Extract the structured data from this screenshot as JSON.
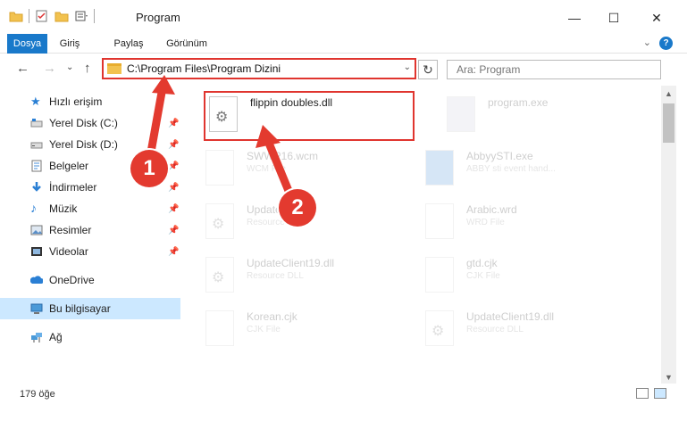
{
  "window": {
    "title": "Program",
    "minimize_glyph": "—",
    "maximize_glyph": "☐",
    "close_glyph": "✕"
  },
  "ribbon": {
    "tabs": [
      "Dosya",
      "Giriş",
      "Paylaş",
      "Görünüm"
    ],
    "expand_glyph": "⌄",
    "help_glyph": "?"
  },
  "nav": {
    "back_glyph": "←",
    "forward_glyph": "→",
    "recent_glyph": "⌄",
    "up_glyph": "↑",
    "address": "C:\\Program Files\\Program Dizini",
    "address_dropdown_glyph": "⌄",
    "refresh_glyph": "↻",
    "search_placeholder": "Ara: Program"
  },
  "sidebar": {
    "items": [
      {
        "label": "Hızlı erişim",
        "icon": "star-icon",
        "pinned": false
      },
      {
        "label": "Yerel Disk (C:)",
        "icon": "drive-icon",
        "pinned": true
      },
      {
        "label": "Yerel Disk (D:)",
        "icon": "drive-icon",
        "pinned": true
      },
      {
        "label": "Belgeler",
        "icon": "documents-icon",
        "pinned": true
      },
      {
        "label": "İndirmeler",
        "icon": "download-icon",
        "pinned": true
      },
      {
        "label": "Müzik",
        "icon": "music-icon",
        "pinned": true
      },
      {
        "label": "Resimler",
        "icon": "pictures-icon",
        "pinned": true
      },
      {
        "label": "Videolar",
        "icon": "videos-icon",
        "pinned": true
      },
      {
        "label": "OneDrive",
        "icon": "cloud-icon",
        "pinned": false
      },
      {
        "label": "Bu bilgisayar",
        "icon": "computer-icon",
        "pinned": false,
        "selected": true
      },
      {
        "label": "Ağ",
        "icon": "network-icon",
        "pinned": false
      }
    ]
  },
  "files": {
    "highlighted": {
      "name": "flippin doubles.dll"
    },
    "background": [
      {
        "name": "program.exe",
        "type": ""
      },
      {
        "name": "SWWP16.wcm",
        "type": "WCM File"
      },
      {
        "name": "AbbyySTI.exe",
        "type": "ABBY sti event hand..."
      },
      {
        "name": "Update...42.dll",
        "type": "Resource DLL"
      },
      {
        "name": "Arabic.wrd",
        "type": "WRD File"
      },
      {
        "name": "UpdateClient19.dll",
        "type": "Resource DLL"
      },
      {
        "name": "gtd.cjk",
        "type": "CJK File"
      },
      {
        "name": "Korean.cjk",
        "type": "CJK File"
      },
      {
        "name": "UpdateClient19.dll",
        "type": "Resource DLL"
      }
    ]
  },
  "annotations": {
    "badge_1": "1",
    "badge_2": "2"
  },
  "status": {
    "count": "179 öğe"
  }
}
